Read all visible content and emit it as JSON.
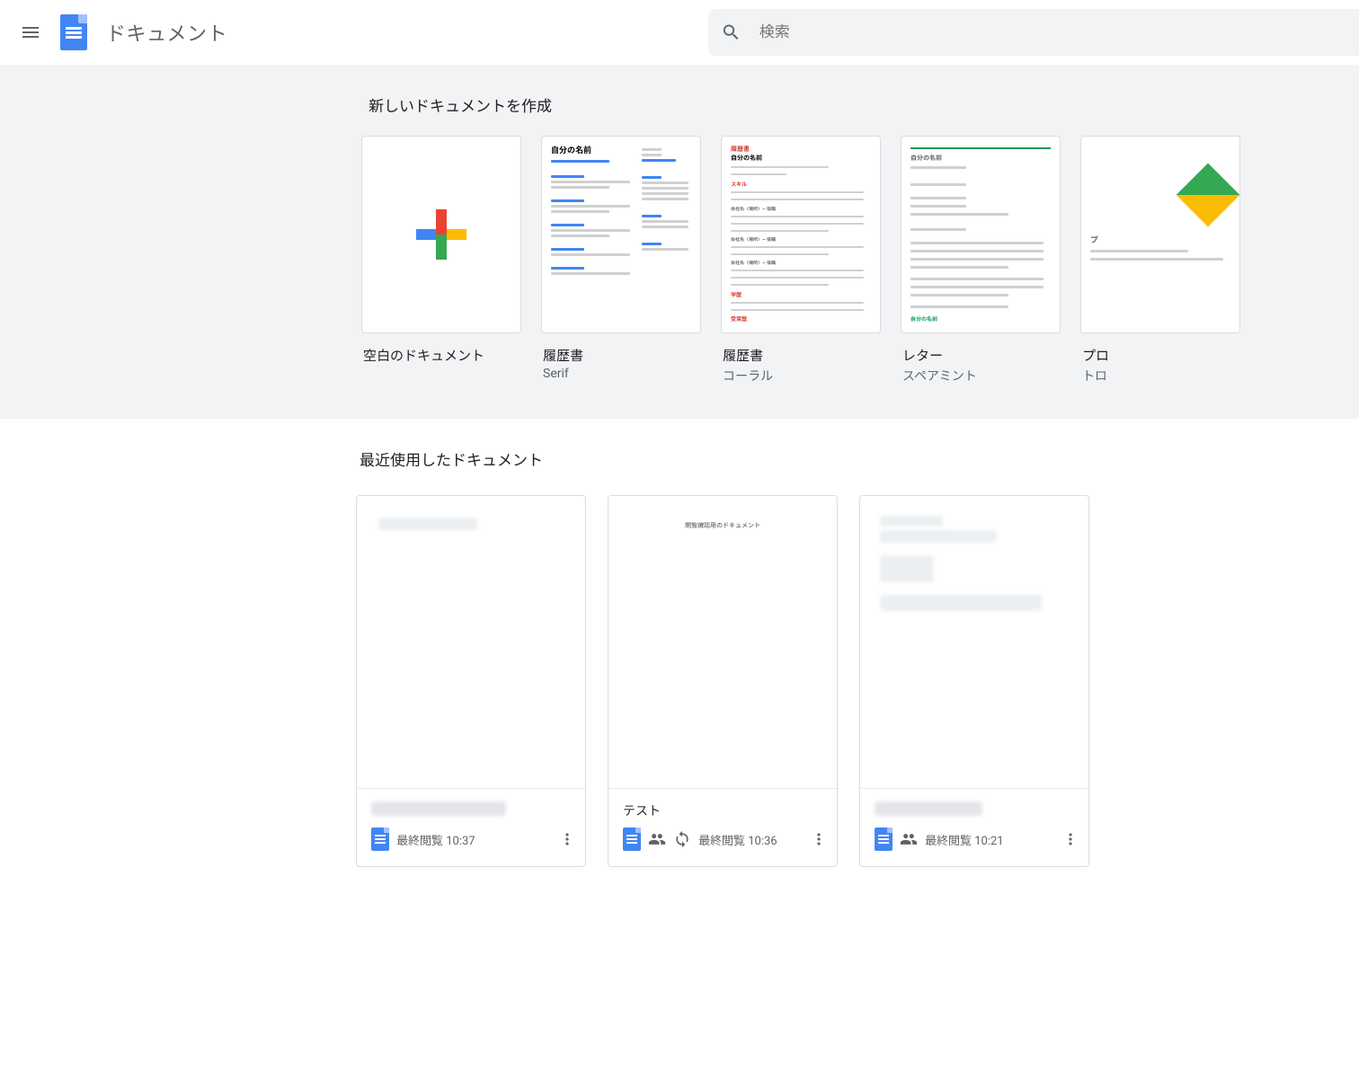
{
  "header": {
    "app_name": "ドキュメント",
    "search_placeholder": "検索"
  },
  "templates": {
    "section_title": "新しいドキュメントを作成",
    "items": [
      {
        "title": "空白のドキュメント",
        "subtitle": ""
      },
      {
        "title": "履歴書",
        "subtitle": "Serif"
      },
      {
        "title": "履歴書",
        "subtitle": "コーラル"
      },
      {
        "title": "レター",
        "subtitle": "スペアミント"
      },
      {
        "title": "プロ",
        "subtitle": "トロ"
      }
    ]
  },
  "recent": {
    "section_title": "最近使用したドキュメント",
    "docs": [
      {
        "name": "",
        "name_redacted": true,
        "shared": false,
        "sync": false,
        "last_seen": "最終閲覧 10:37",
        "preview_title_redacted": true
      },
      {
        "name": "テスト",
        "name_redacted": false,
        "shared": true,
        "sync": true,
        "last_seen": "最終閲覧 10:36",
        "preview_title": "閲覧確認用のドキュメント"
      },
      {
        "name": "",
        "name_redacted": true,
        "shared": true,
        "sync": false,
        "last_seen": "最終閲覧 10:21",
        "preview_title_redacted": true
      }
    ]
  }
}
